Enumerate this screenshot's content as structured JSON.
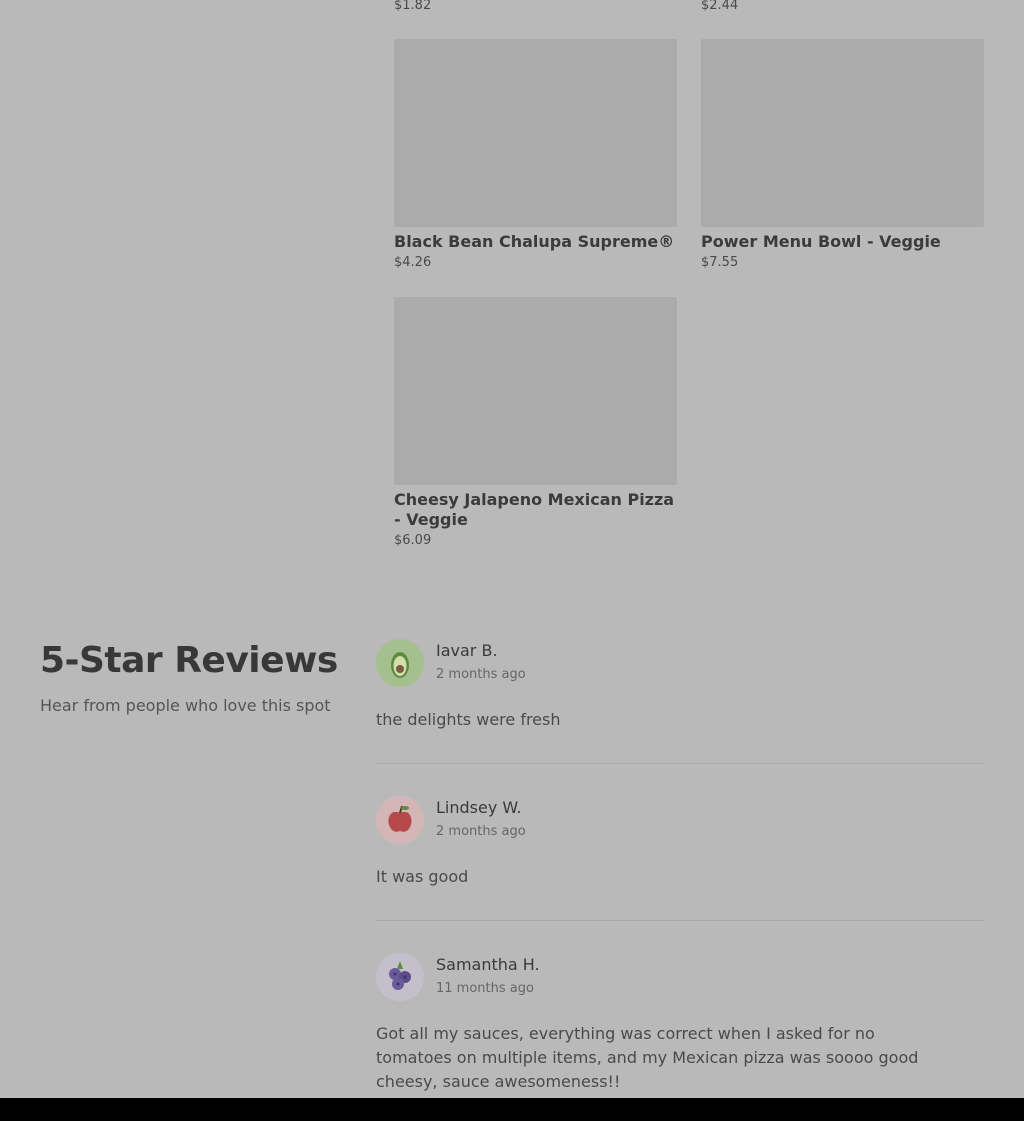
{
  "menu": {
    "top_prices": [
      "$1.82",
      "$2.44"
    ],
    "items": [
      {
        "name": "Black Bean Chalupa Supreme®",
        "price": "$4.26"
      },
      {
        "name": "Power Menu Bowl - Veggie",
        "price": "$7.55"
      },
      {
        "name": "Cheesy Jalapeno Mexican Pizza - Veggie",
        "price": "$6.09"
      }
    ]
  },
  "reviews": {
    "title": "5-Star Reviews",
    "subtitle": "Hear from people who love this spot",
    "items": [
      {
        "name": "Iavar B.",
        "time": "2 months ago",
        "text": "the delights were fresh",
        "avatar": "avocado-icon",
        "avatar_bg": "#a3c08e"
      },
      {
        "name": "Lindsey W.",
        "time": "2 months ago",
        "text": "It was good",
        "avatar": "apple-icon",
        "avatar_bg": "#d4b6b6"
      },
      {
        "name": "Samantha H.",
        "time": "11 months ago",
        "text": "Got all my sauces, everything was correct when I asked for no tomatoes on multiple items, and my Mexican pizza was soooo good cheesy, sauce awesomeness!!",
        "avatar": "blueberry-icon",
        "avatar_bg": "#c3c0cc"
      }
    ]
  }
}
